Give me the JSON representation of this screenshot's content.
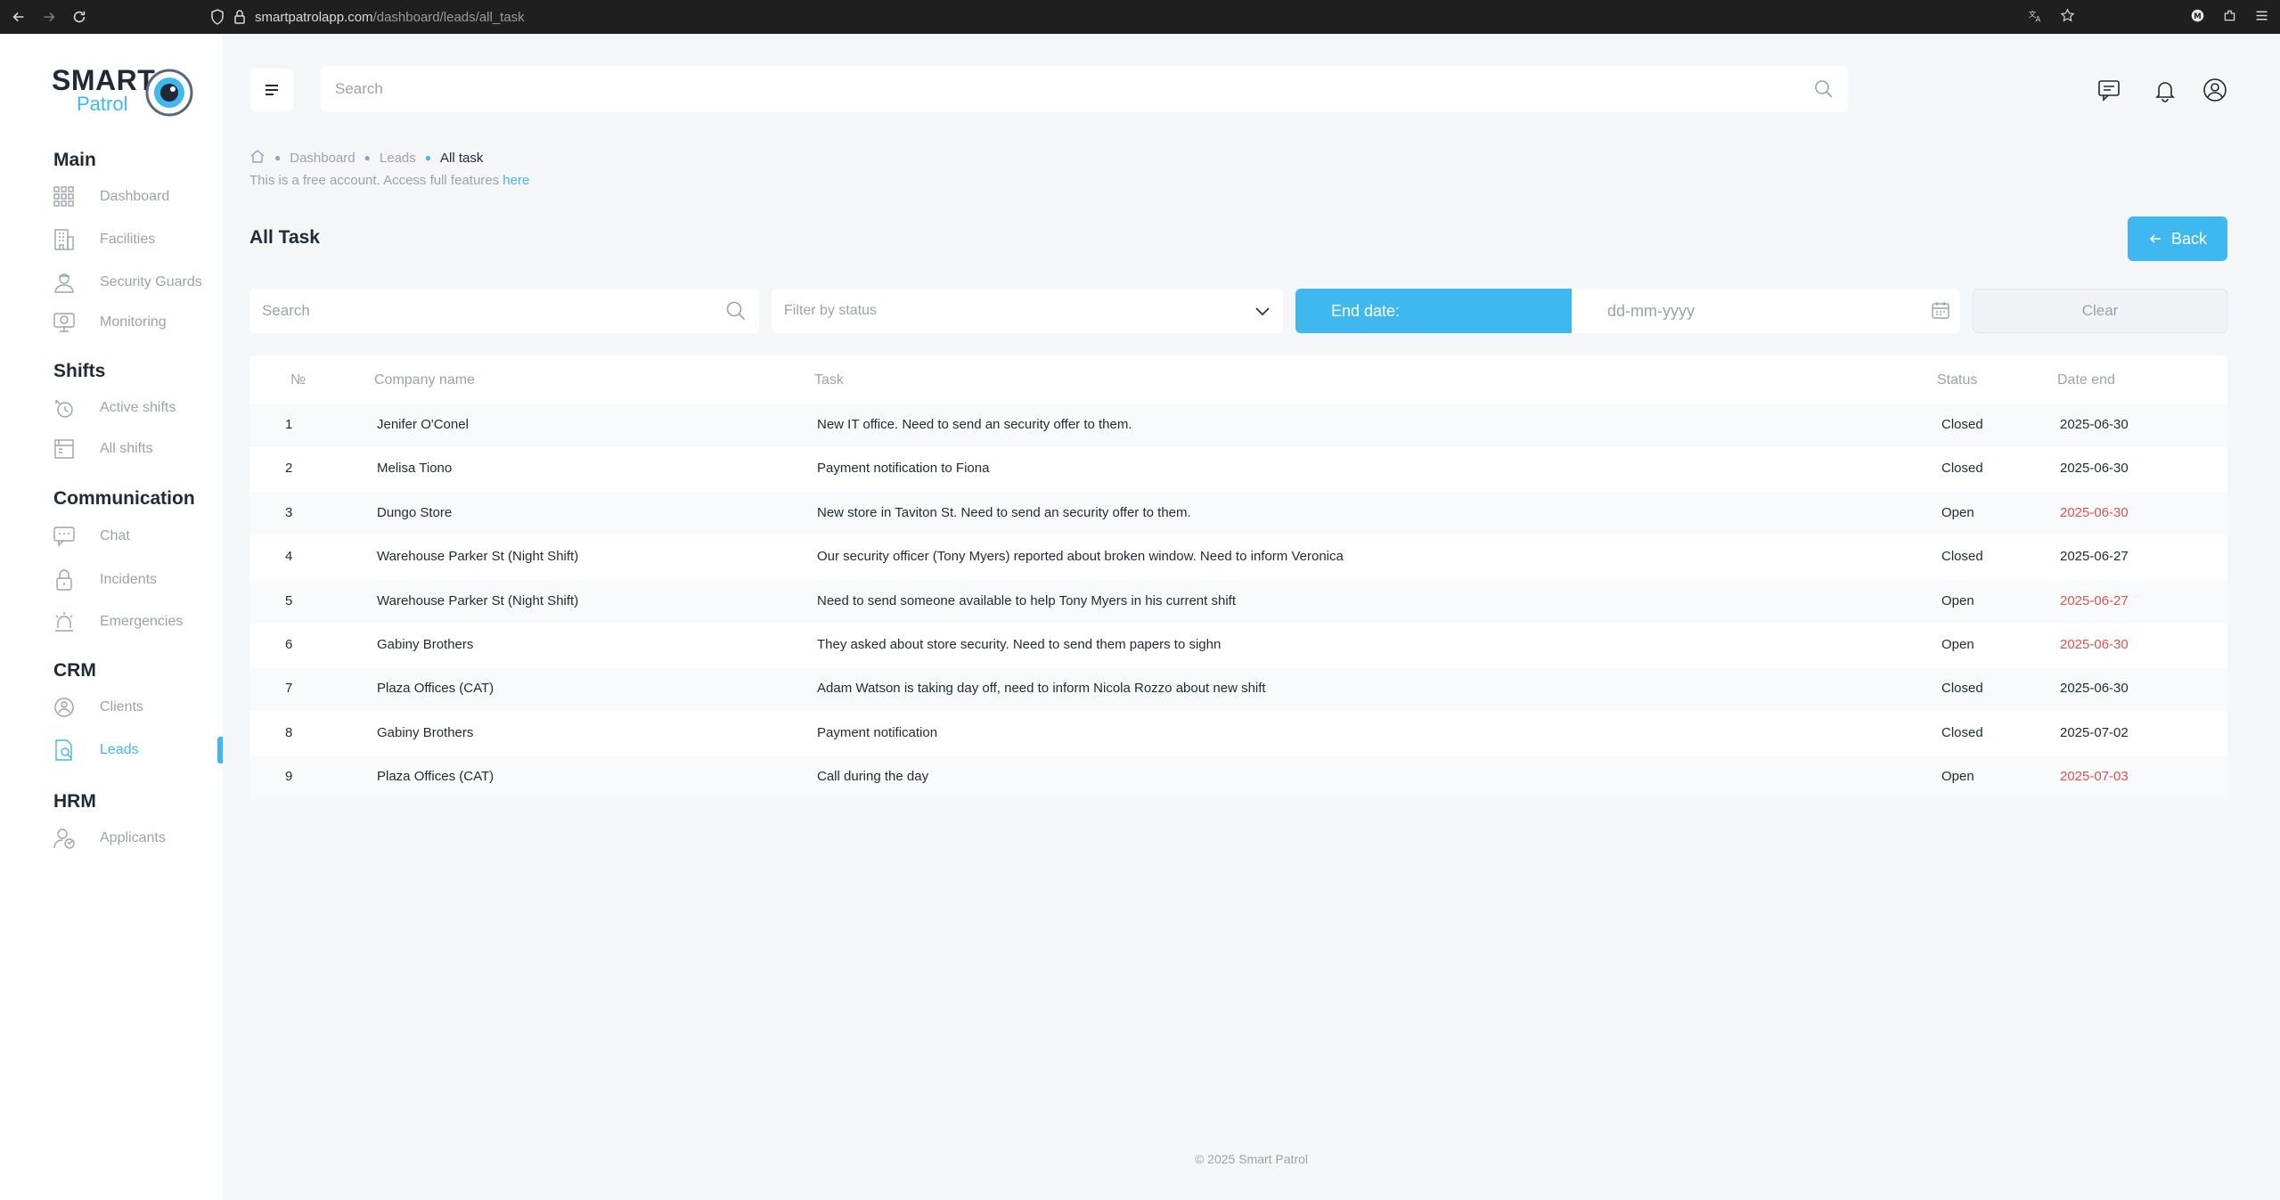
{
  "browser": {
    "url_host": "smartpatrolapp.com",
    "url_path": "/dashboard/leads/all_task"
  },
  "logo": {
    "line1": "SMART",
    "line2": "Patrol"
  },
  "sidebar": {
    "sections": [
      {
        "title": "Main",
        "items": [
          {
            "label": "Dashboard",
            "icon": "dashboard-icon"
          },
          {
            "label": "Facilities",
            "icon": "building-icon"
          },
          {
            "label": "Security Guards",
            "icon": "guard-icon"
          },
          {
            "label": "Monitoring",
            "icon": "monitoring-icon"
          }
        ]
      },
      {
        "title": "Shifts",
        "items": [
          {
            "label": "Active shifts",
            "icon": "active-shifts-icon"
          },
          {
            "label": "All shifts",
            "icon": "all-shifts-icon"
          }
        ]
      },
      {
        "title": "Communication",
        "items": [
          {
            "label": "Chat",
            "icon": "chat-icon"
          },
          {
            "label": "Incidents",
            "icon": "incidents-icon"
          },
          {
            "label": "Emergencies",
            "icon": "emergency-icon"
          }
        ]
      },
      {
        "title": "CRM",
        "items": [
          {
            "label": "Clients",
            "icon": "clients-icon"
          },
          {
            "label": "Leads",
            "icon": "leads-icon",
            "active": true
          }
        ]
      },
      {
        "title": "HRM",
        "items": [
          {
            "label": "Applicants",
            "icon": "applicants-icon"
          }
        ]
      }
    ]
  },
  "header": {
    "search_placeholder": "Search"
  },
  "breadcrumb": {
    "items": [
      "Dashboard",
      "Leads"
    ],
    "current": "All task"
  },
  "notice": {
    "text": "This is a free account. Access full features ",
    "link": "here"
  },
  "page": {
    "title": "All Task",
    "back_label": "Back"
  },
  "filters": {
    "search_placeholder": "Search",
    "status_placeholder": "Filter by status",
    "end_date_label": "End date:",
    "date_placeholder": "dd-mm-yyyy",
    "clear_label": "Clear"
  },
  "table": {
    "headers": [
      "№",
      "Company name",
      "Task",
      "Status",
      "Date end"
    ],
    "rows": [
      {
        "n": "1",
        "company": "Jenifer O'Conel",
        "task": "New IT office. Need to send an security offer to them.",
        "status": "Closed",
        "date": "2025-06-30",
        "overdue": false
      },
      {
        "n": "2",
        "company": "Melisa Tiono",
        "task": "Payment notification to Fiona",
        "status": "Closed",
        "date": "2025-06-30",
        "overdue": false
      },
      {
        "n": "3",
        "company": "Dungo Store",
        "task": "New store in Taviton St. Need to send an security offer to them.",
        "status": "Open",
        "date": "2025-06-30",
        "overdue": true
      },
      {
        "n": "4",
        "company": "Warehouse Parker St (Night Shift)",
        "task": "Our security officer (Tony Myers) reported about broken window. Need to inform Veronica",
        "status": "Closed",
        "date": "2025-06-27",
        "overdue": false
      },
      {
        "n": "5",
        "company": "Warehouse Parker St (Night Shift)",
        "task": "Need to send someone available to help Tony Myers in his current shift",
        "status": "Open",
        "date": "2025-06-27",
        "overdue": true
      },
      {
        "n": "6",
        "company": "Gabiny Brothers",
        "task": "They asked about store security. Need to send them papers to sighn",
        "status": "Open",
        "date": "2025-06-30",
        "overdue": true
      },
      {
        "n": "7",
        "company": "Plaza Offices (CAT)",
        "task": "Adam Watson is taking day off, need to inform Nicola Rozzo about new shift",
        "status": "Closed",
        "date": "2025-06-30",
        "overdue": false
      },
      {
        "n": "8",
        "company": "Gabiny Brothers",
        "task": "Payment notification",
        "status": "Closed",
        "date": "2025-07-02",
        "overdue": false
      },
      {
        "n": "9",
        "company": "Plaza Offices (CAT)",
        "task": "Call during the day",
        "status": "Open",
        "date": "2025-07-03",
        "overdue": true
      }
    ]
  },
  "footer": {
    "text": "© 2025 Smart Patrol"
  },
  "colors": {
    "accent": "#3fb8ef",
    "overdue": "#d9534f",
    "text": "#1f2a36",
    "muted": "#9aa3ad"
  }
}
